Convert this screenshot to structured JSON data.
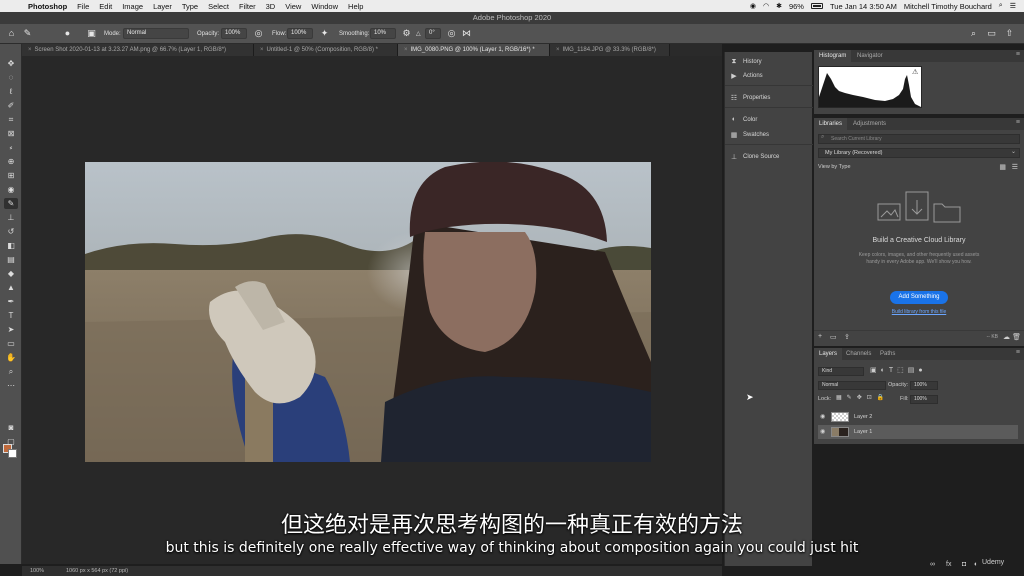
{
  "menubar": {
    "app": "Photoshop",
    "items": [
      "File",
      "Edit",
      "Image",
      "Layer",
      "Type",
      "Select",
      "Filter",
      "3D",
      "View",
      "Window",
      "Help"
    ],
    "datetime": "Tue Jan 14  3:50 AM",
    "user": "Mitchell Timothy Bouchard",
    "battery": "96%"
  },
  "window": {
    "title": "Adobe Photoshop 2020"
  },
  "options": {
    "mode_label": "Mode:",
    "mode_value": "Normal",
    "opacity_label": "Opacity:",
    "opacity_value": "100%",
    "flow_label": "Flow:",
    "flow_value": "100%",
    "smoothing_label": "Smoothing:",
    "smoothing_value": "10%",
    "angle_value": "0°"
  },
  "tabs": [
    "Screen Shot 2020-01-13 at 3.23.27 AM.png @ 66.7% (Layer 1, RGB/8*)",
    "Untitled-1 @ 50% (Composition, RGB/8) *",
    "IMG_0080.PNG @ 100% (Layer 1, RGB/16*) *",
    "IMG_1184.JPG @ 33.3% (RGB/8*)"
  ],
  "sidepanels": {
    "items": [
      "History",
      "Actions",
      "Properties",
      "Color",
      "Swatches",
      "Clone Source"
    ]
  },
  "histogram": {
    "tabs": [
      "Histogram",
      "Navigator"
    ]
  },
  "libraries": {
    "tabs": [
      "Libraries",
      "Adjustments"
    ],
    "search_placeholder": "Search Current Library",
    "library_select": "My Library (Recovered)",
    "view_by": "View by Type",
    "title": "Build a Creative Cloud Library",
    "body": "Keep colors, images, and other frequently used assets handy in every Adobe app. We'll show you how.",
    "button": "Add Something",
    "link": "Build library from this file",
    "size": "-- KB"
  },
  "layers": {
    "tabs": [
      "Layers",
      "Channels",
      "Paths"
    ],
    "filter": "Kind",
    "blend": "Normal",
    "opacity_label": "Opacity:",
    "opacity_value": "100%",
    "lock_label": "Lock:",
    "fill_label": "Fill:",
    "fill_value": "100%",
    "items": [
      {
        "name": "Layer 2",
        "selected": false
      },
      {
        "name": "Layer 1",
        "selected": true
      }
    ]
  },
  "status": {
    "zoom": "100%",
    "doc": "1060 px x 564 px (72 ppi)"
  },
  "subtitles": {
    "zh": "但这绝对是再次思考构图的一种真正有效的方法",
    "en": "but this is definitely one really effective way of thinking about composition again you could just hit"
  },
  "watermark": "Udemy"
}
